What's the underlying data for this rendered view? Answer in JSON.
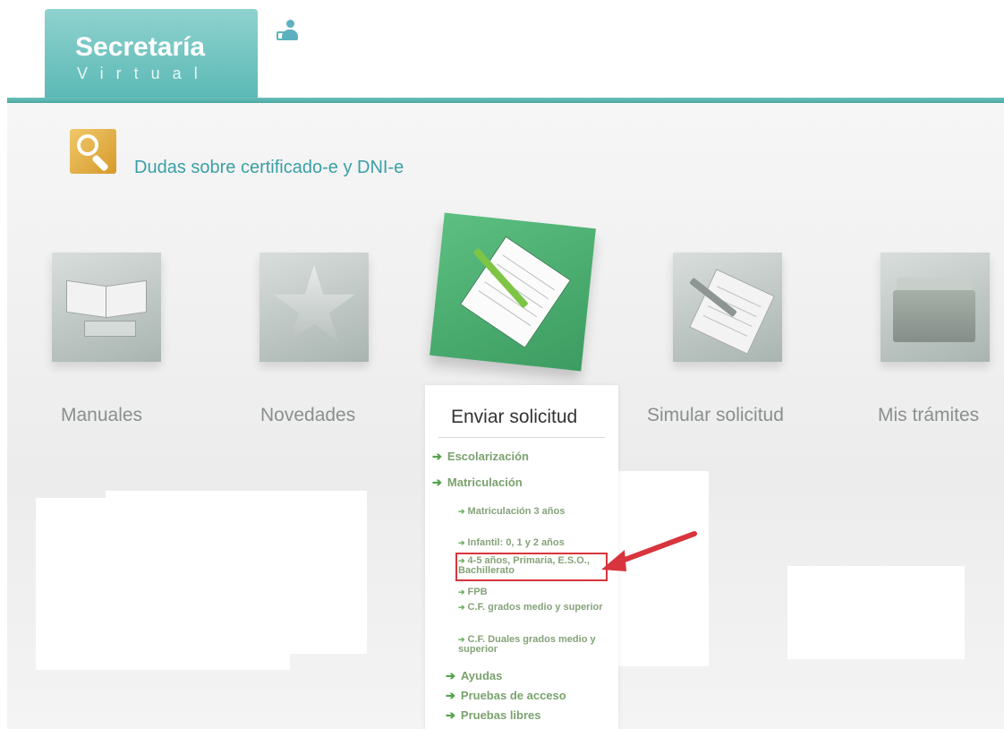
{
  "header": {
    "logo_line1": "Secretaría",
    "logo_line2": "Virtual"
  },
  "help": {
    "link_text": "Dudas sobre certificado-e y DNI-e"
  },
  "tiles": [
    {
      "label": "Manuales",
      "icon": "book-icon"
    },
    {
      "label": "Novedades",
      "icon": "star-icon"
    },
    {
      "label": "Enviar solicitud",
      "icon": "notepad-pen-icon",
      "active": true
    },
    {
      "label": "Simular solicitud",
      "icon": "notepad-icon"
    },
    {
      "label": "Mis trámites",
      "icon": "folder-icon"
    }
  ],
  "menu": {
    "escolarizacion": "Escolarización",
    "matriculacion": "Matriculación",
    "sub": [
      {
        "label": "Matriculación 3 años"
      },
      {
        "label": "Infantil: 0, 1 y 2 años"
      },
      {
        "label": "4-5 años, Primaria, E.S.O., Bachillerato"
      },
      {
        "label": "FPB"
      },
      {
        "label": "C.F. grados medio y superior"
      },
      {
        "label": "C.F. Duales grados medio y superior"
      }
    ],
    "ayudas": "Ayudas",
    "pruebas_acceso": "Pruebas de acceso",
    "pruebas_libres": "Pruebas libres"
  },
  "colors": {
    "brand_teal": "#5bb9b5",
    "active_green": "#3c9c61",
    "menu_green": "#7aa26e",
    "highlight_red": "#d8343d"
  }
}
